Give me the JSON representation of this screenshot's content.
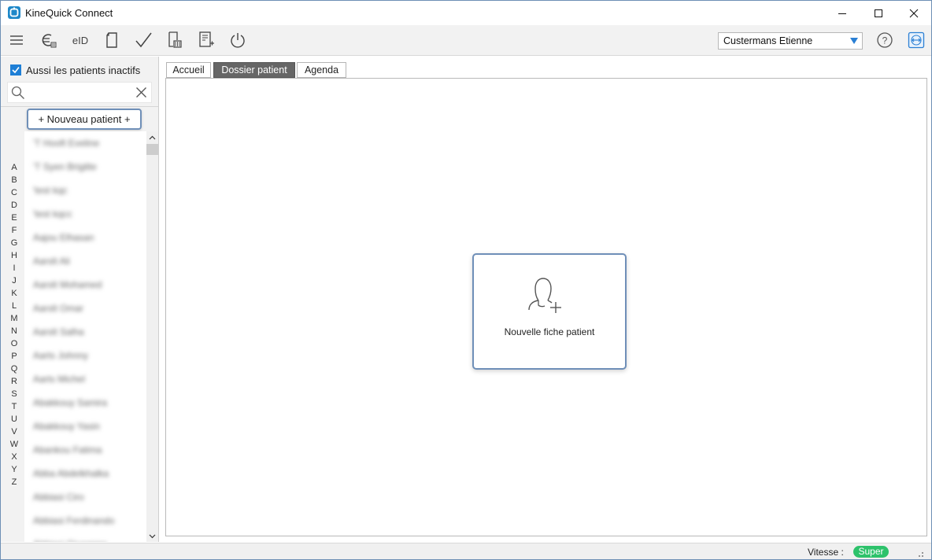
{
  "window": {
    "title": "KineQuick Connect"
  },
  "toolbar": {
    "menu_icon": "hamburger-icon",
    "items": [
      {
        "name": "billing",
        "icon": "euro-icon"
      },
      {
        "name": "eid",
        "label": "eID"
      },
      {
        "name": "document",
        "icon": "document-icon"
      },
      {
        "name": "validate",
        "icon": "checkmark-icon"
      },
      {
        "name": "archive",
        "icon": "archive-icon"
      },
      {
        "name": "reports",
        "icon": "report-icon"
      },
      {
        "name": "logout",
        "icon": "power-icon"
      }
    ],
    "user_select": {
      "value": "Custermans Etienne"
    },
    "accent": "#1e7fd6"
  },
  "sidebar": {
    "inactive_patients_label": "Aussi les patients inactifs",
    "inactive_patients_checked": true,
    "search": {
      "value": "",
      "placeholder": ""
    },
    "new_patient_label": "+ Nouveau patient +",
    "alphabet": [
      "A",
      "B",
      "C",
      "D",
      "E",
      "F",
      "G",
      "H",
      "I",
      "J",
      "K",
      "L",
      "M",
      "N",
      "O",
      "P",
      "Q",
      "R",
      "S",
      "T",
      "U",
      "V",
      "W",
      "X",
      "Y",
      "Z"
    ],
    "patients": [
      "'T Hooft Eveline",
      "'T Syen Brigitte",
      "'test kqc",
      "'test kqcc",
      "Aajou Elhasan",
      "Aarslt Ali",
      "Aarslt Mohamed",
      "Aarslt Omar",
      "Aarslt Salha",
      "Aarts Johnny",
      "Aarts Michel",
      "Abakkouy Samira",
      "Abakkouy Yasin",
      "Abankou Fatima",
      "Abba Abdelkhalka",
      "Abbiasi Ciro",
      "Abbiasi Ferdinando",
      "Abbiasi Giuseppe"
    ]
  },
  "tabs": [
    {
      "label": "Accueil",
      "active": false
    },
    {
      "label": "Dossier patient",
      "active": true
    },
    {
      "label": "Agenda",
      "active": false
    }
  ],
  "main": {
    "new_record_label": "Nouvelle fiche patient",
    "new_record_icon": "add-user-icon"
  },
  "status": {
    "speed_label": "Vitesse :",
    "speed_value": "Super",
    "speed_color": "#2dc26b"
  }
}
